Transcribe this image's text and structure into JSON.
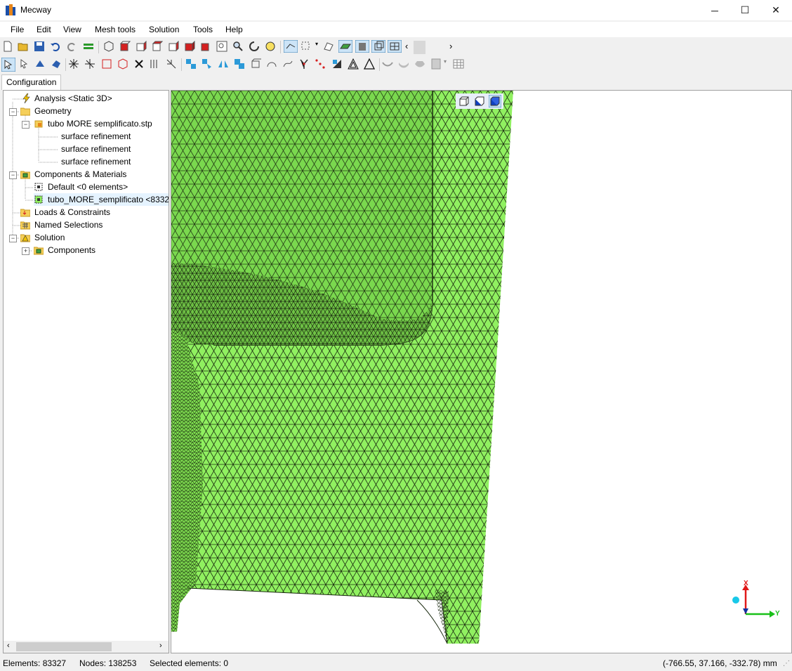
{
  "window": {
    "title": "Mecway",
    "minimize": "─",
    "maximize": "☐",
    "close": "✕"
  },
  "menu": [
    "File",
    "Edit",
    "View",
    "Mesh tools",
    "Solution",
    "Tools",
    "Help"
  ],
  "tabs": {
    "configuration": "Configuration"
  },
  "tree": {
    "analysis": "Analysis <Static 3D>",
    "geometry": "Geometry",
    "geometry_file": "tubo MORE semplificato.stp",
    "refinements": [
      "surface refinement",
      "surface refinement",
      "surface refinement"
    ],
    "components_materials": "Components & Materials",
    "default_component": "Default <0 elements>",
    "tubo_component": "tubo_MORE_semplificato <8332",
    "loads": "Loads & Constraints",
    "named_selections": "Named Selections",
    "solution": "Solution",
    "solution_components": "Components"
  },
  "axes": {
    "x": "X",
    "y": "Y"
  },
  "status": {
    "elements": "Elements: 83327",
    "nodes": "Nodes: 138253",
    "selected": "Selected elements: 0",
    "coords": "(-766.55, 37.166, -332.78) mm"
  },
  "colors": {
    "mesh_fill": "#90f060",
    "mesh_line": "#1a2a10",
    "accent": "#0a64c8"
  }
}
